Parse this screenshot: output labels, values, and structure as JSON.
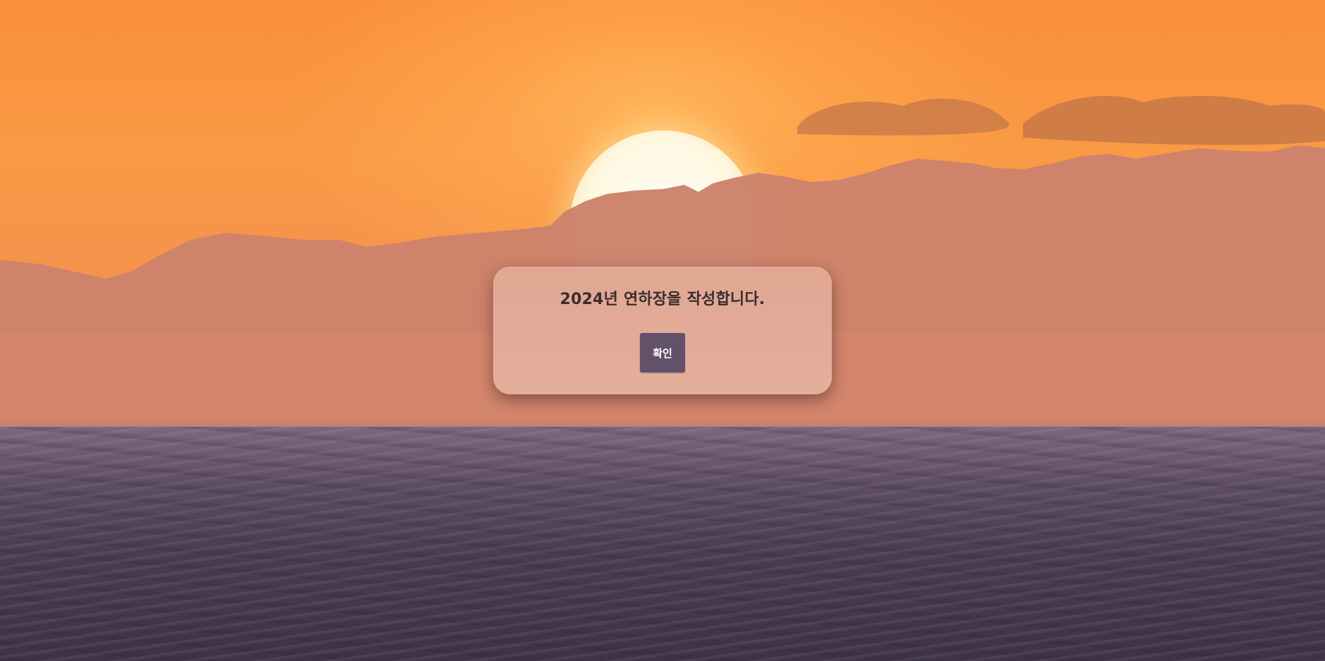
{
  "background": {
    "scene": "sunset-over-ocean",
    "colors": {
      "sky_top": "#fb8f3a",
      "sun": "#fffdf4",
      "mountains": "#c9826c",
      "sea": "#4a3b50"
    }
  },
  "dialog": {
    "message": "2024년 연하장을 작성합니다.",
    "confirm_label": "확인",
    "confirm_color": "#625169"
  }
}
